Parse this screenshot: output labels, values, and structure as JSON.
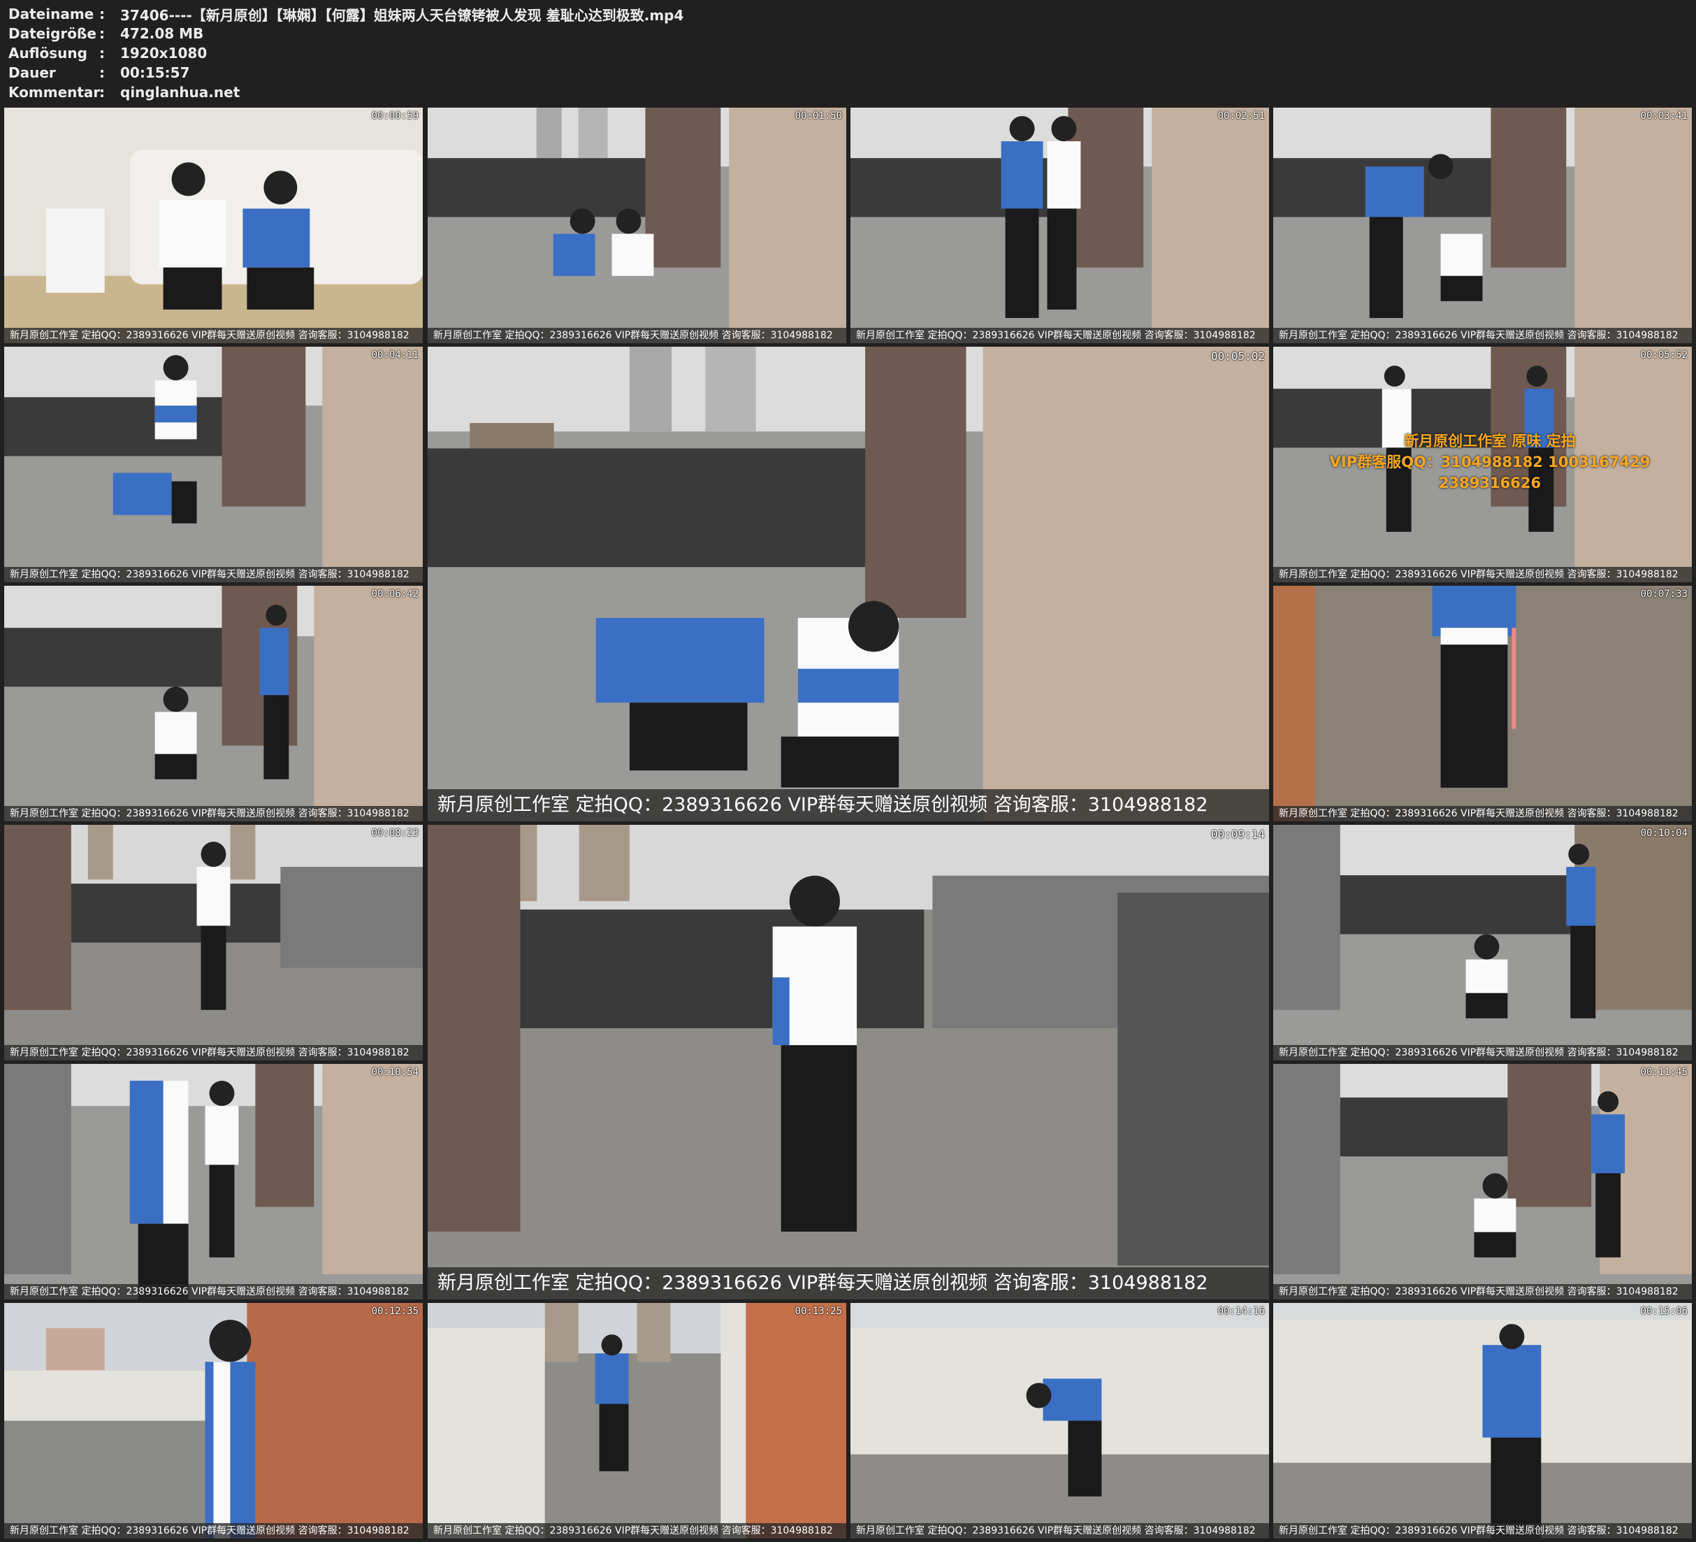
{
  "file_info": {
    "rows": [
      {
        "label": "Dateiname",
        "value": "37406----【新月原创】【琳娴】【何露】姐妹两人天台镣铐被人发现 羞耻心达到极致.mp4"
      },
      {
        "label": "Dateigröße",
        "value": "472.08 MB"
      },
      {
        "label": "Auflösung",
        "value": "1920x1080"
      },
      {
        "label": "Dauer",
        "value": "00:15:57"
      },
      {
        "label": "Kommentar",
        "value": "qinglanhua.net"
      }
    ],
    "colon": ":"
  },
  "watermark": "新月原创工作室   定拍QQ：2389316626 VIP群每天赠送原创视频 咨询客服：3104988182",
  "overlay": {
    "line1": "新月原创工作室 原味 定拍",
    "line2": "VIP群客服QQ：3104988182  1003167429",
    "line3": "2389316626"
  },
  "thumbnails": [
    {
      "timestamp": "00:00:59",
      "scene": "indoor"
    },
    {
      "timestamp": "00:01:50",
      "scene": "rooftop"
    },
    {
      "timestamp": "00:02:51",
      "scene": "rooftop"
    },
    {
      "timestamp": "00:03:41",
      "scene": "rooftop"
    },
    {
      "timestamp": "00:04:11",
      "scene": "rooftop"
    },
    {
      "timestamp": "00:05:02",
      "scene": "rooftop"
    },
    {
      "timestamp": "00:05:52",
      "scene": "rooftop"
    },
    {
      "timestamp": "00:06:42",
      "scene": "rooftop"
    },
    {
      "timestamp": "00:07:33",
      "scene": "tiles"
    },
    {
      "timestamp": "00:08:23",
      "scene": "rooftop"
    },
    {
      "timestamp": "00:09:14",
      "scene": "rooftop"
    },
    {
      "timestamp": "00:10:04",
      "scene": "rooftop"
    },
    {
      "timestamp": "00:10:54",
      "scene": "rooftop"
    },
    {
      "timestamp": "00:11:45",
      "scene": "rooftop"
    },
    {
      "timestamp": "00:12:35",
      "scene": "brickwall"
    },
    {
      "timestamp": "00:13:25",
      "scene": "alley"
    },
    {
      "timestamp": "00:14:16",
      "scene": "whitewall"
    },
    {
      "timestamp": "00:15:06",
      "scene": "whitewall"
    }
  ],
  "colors": {
    "background": "#202020",
    "header_text": "#ededed",
    "uniform_blue": "#3a6fc4",
    "watermark_bar": "#282828",
    "overlay_text": "#f5a623"
  }
}
